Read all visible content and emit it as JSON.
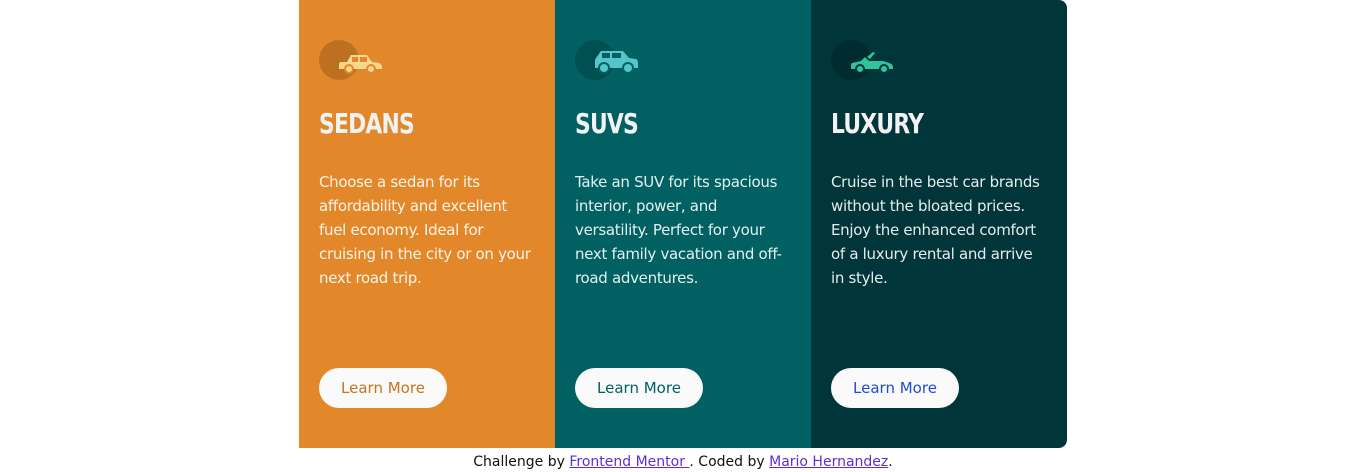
{
  "cards": [
    {
      "icon": "sedan-car-icon",
      "title": "SEDANS",
      "text": "Choose a sedan for its affordability and excellent fuel economy. Ideal for cruising in the city or on your next road trip.",
      "button": "Learn More",
      "background": "#e2882a",
      "icon_color": "#f6d78b",
      "bubble_color": "#7a4412",
      "button_text_color": "#c6741e"
    },
    {
      "icon": "suv-car-icon",
      "title": "SUVS",
      "text": "Take an SUV for its spacious interior, power, and versatility. Perfect for your next family vacation and off-road adventures.",
      "button": "Learn More",
      "background": "#006062",
      "icon_color": "#54c6c9",
      "bubble_color": "#003537",
      "button_text_color": "#006062"
    },
    {
      "icon": "luxury-car-icon",
      "title": "LUXURY",
      "text": "Cruise in the best car brands without the bloated prices. Enjoy the enhanced comfort of a luxury rental and arrive in style.",
      "button": "Learn More",
      "background": "#003539",
      "icon_color": "#2fc39e",
      "bubble_color": "#001c1e",
      "button_text_color": "#1f4dd6"
    }
  ],
  "footer": {
    "prefix": "Challenge by ",
    "link1": "Frontend Mentor ",
    "middle": ". Coded by ",
    "link2": "Mario Hernandez",
    "suffix": "."
  }
}
